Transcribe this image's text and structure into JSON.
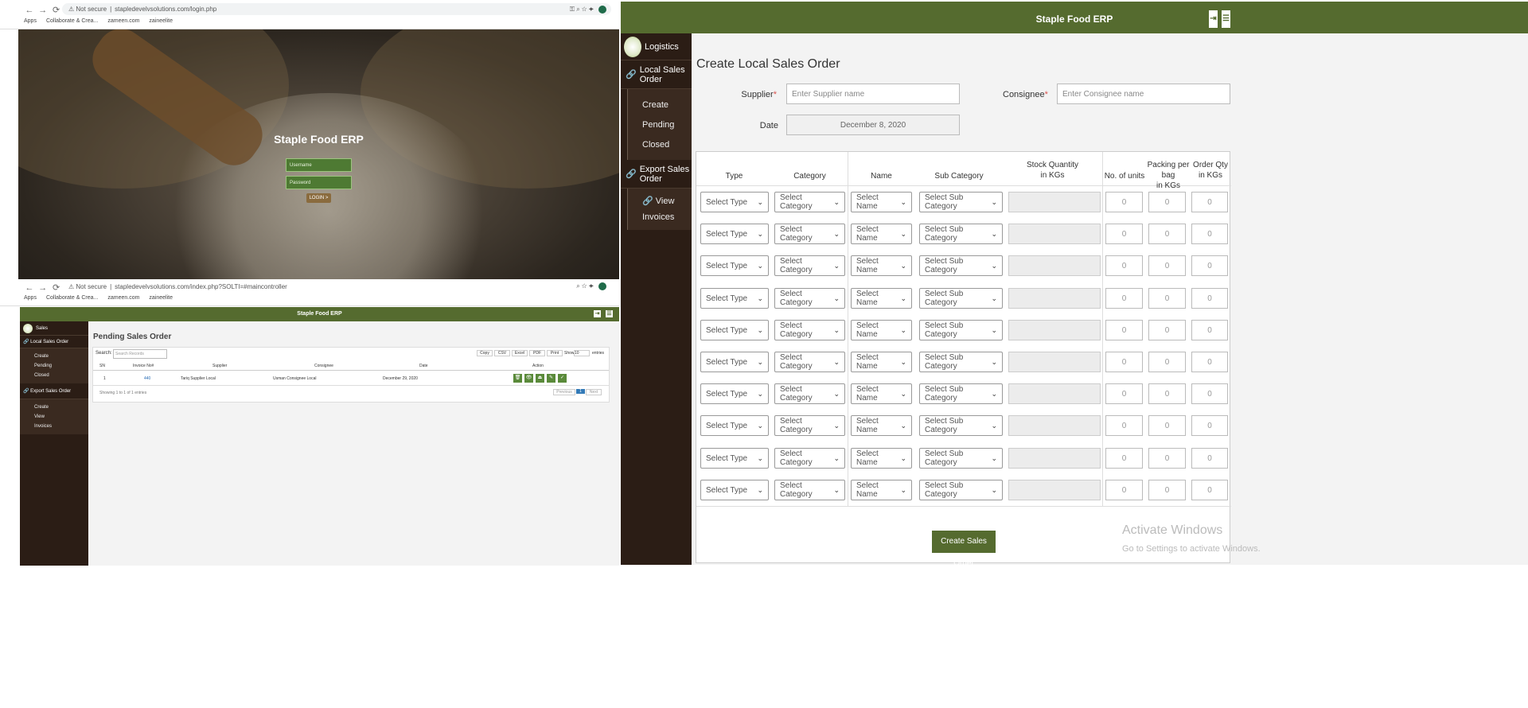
{
  "login_window": {
    "browser": {
      "security": "Not secure",
      "url": "stapledevelvsolutions.com/login.php",
      "bookmarks": [
        "Apps",
        "Collaborate & Crea...",
        "zameen.com",
        "zaineelite"
      ]
    },
    "title": "Staple Food ERP",
    "username_placeholder": "Username",
    "password_placeholder": "Password",
    "login_button": "LOGIN >"
  },
  "pending_window": {
    "browser": {
      "security": "Not secure",
      "url": "stapledevelvsolutions.com/index.php?SOLTI=#maincontroller",
      "bookmarks": [
        "Apps",
        "Collaborate & Crea...",
        "zameen.com",
        "zaineelite"
      ]
    },
    "header_title": "Staple Food ERP",
    "sidebar": {
      "module": "Sales",
      "sections": [
        {
          "label": "Local Sales Order",
          "items": [
            "Create",
            "Pending",
            "Closed"
          ]
        },
        {
          "label": "Export Sales Order",
          "items": [
            "Create",
            "View",
            "Invoices"
          ]
        }
      ]
    },
    "page_title": "Pending Sales Order",
    "search_label": "Search:",
    "search_placeholder": "Search Records",
    "export_buttons": [
      "Copy",
      "CSV",
      "Excel",
      "PDF",
      "Print"
    ],
    "show_label": "Show",
    "show_value": "10",
    "entries_label": "entries",
    "columns": [
      "SN",
      "Invoice No#",
      "Supplier",
      "Consignee",
      "Date",
      "Action"
    ],
    "rows": [
      {
        "sn": "1",
        "invoice": "440",
        "supplier": "Tariq Supplier Local",
        "consignee": "Usman Consignee Local",
        "date": "December 29, 2020"
      }
    ],
    "info": "Showing 1 to 1 of 1 entries",
    "pagination": {
      "previous": "Previous",
      "current": "1",
      "next": "Next"
    }
  },
  "create_window": {
    "header_title": "Staple Food ERP",
    "sidebar": {
      "module": "Logistics",
      "local_sales_order": "Local Sales Order",
      "local_items": [
        "Create",
        "Pending",
        "Closed"
      ],
      "export_sales_order": "Export Sales Order",
      "export_items": [
        "View Invoices"
      ]
    },
    "page_title": "Create Local Sales Order",
    "supplier_label": "Supplier",
    "supplier_placeholder": "Enter Supplier name",
    "consignee_label": "Consignee",
    "consignee_placeholder": "Enter Consignee name",
    "date_label": "Date",
    "date_value": "December 8, 2020",
    "columns": {
      "type": "Type",
      "category": "Category",
      "name": "Name",
      "sub_category": "Sub Category",
      "stock_l1": "Stock Quantity",
      "stock_l2": "in KGs",
      "units": "No. of units",
      "packing_l1": "Packing per bag",
      "packing_l2": "in KGs",
      "order_l1": "Order Qty",
      "order_l2": "in KGs"
    },
    "row_defaults": {
      "type": "Select Type",
      "category": "Select Category",
      "name": "Select Name",
      "sub_category": "Select Sub Category",
      "units": "0",
      "packing": "0",
      "order": "0"
    },
    "row_count": 10,
    "submit_label": "Create Sales Order",
    "watermark_title": "Activate Windows",
    "watermark_sub": "Go to Settings to activate Windows."
  }
}
